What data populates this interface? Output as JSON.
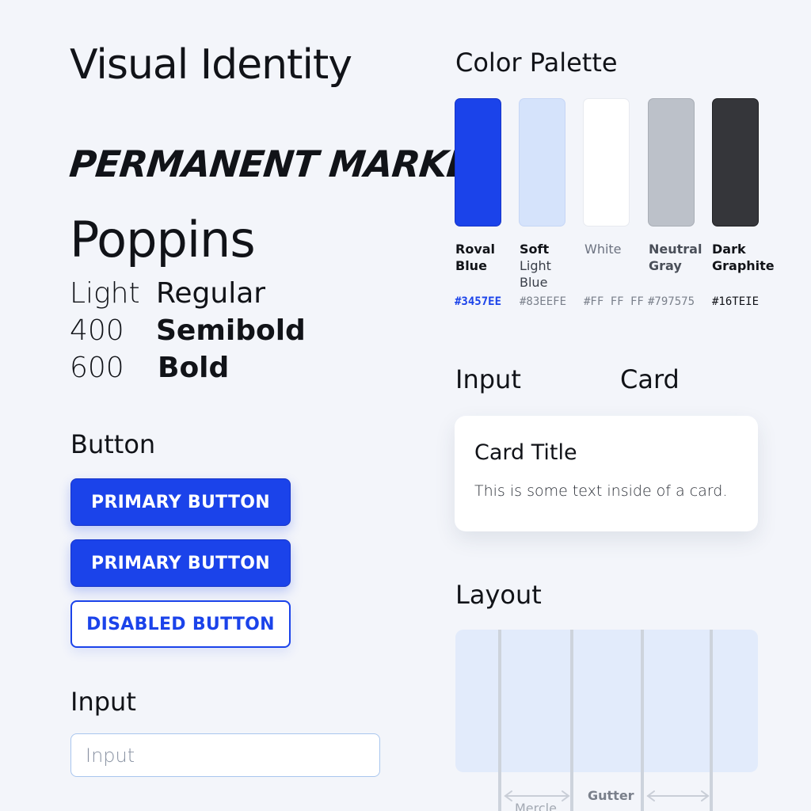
{
  "header": {
    "title": "Visual Identity"
  },
  "typography": {
    "display_font": "Permanent Marker",
    "body_font": "Poppins",
    "weights": {
      "light": "Light",
      "regular": "Regular",
      "w400": "400",
      "semibold": "Semibold",
      "w600": "600",
      "bold": "Bold"
    }
  },
  "buttons": {
    "section_label": "Button",
    "primary_1": "PRIMARY BUTTON",
    "primary_2": "PRIMARY BUTTON",
    "disabled": "DISABLED BUTTON"
  },
  "input": {
    "section_label": "Input",
    "placeholder": "Input"
  },
  "palette": {
    "title": "Color Palette",
    "colors": [
      {
        "name_line1": "Roval",
        "name_line2": "Blue",
        "hex": "#3457EE",
        "swatch": "#1b43ea"
      },
      {
        "name_line1": "Soft",
        "name_line2": "Light",
        "name_line3": "Blue",
        "hex": "#83EEFE",
        "swatch": "#d5e3fb"
      },
      {
        "name_line1": "White",
        "hex": "#FF FF FF",
        "swatch": "#ffffff"
      },
      {
        "name_line1": "Neutral",
        "name_line2": "Gray",
        "hex": "#797575",
        "swatch": "#bcc1c9"
      },
      {
        "name_line1": "Dark",
        "name_line2": "Graphite",
        "hex": "#16TEIE",
        "swatch": "#35363a"
      }
    ]
  },
  "components": {
    "input_heading": "Input",
    "card_heading": "Card",
    "card": {
      "title": "Card Title",
      "text": "This is some text inside of a card."
    }
  },
  "layout": {
    "heading": "Layout",
    "gutter_label": "Gutter",
    "margin_label": "Mercle"
  },
  "colors": {
    "accent": "#1b43ea",
    "background": "#f3f5fa",
    "text": "#111318"
  }
}
